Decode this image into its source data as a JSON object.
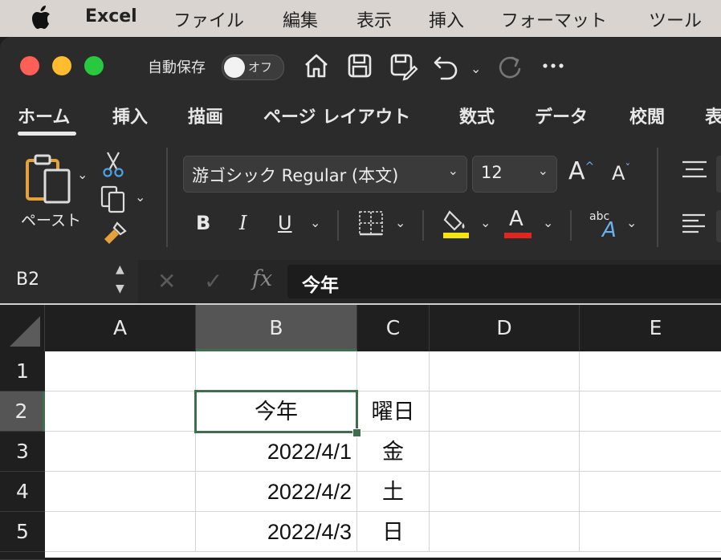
{
  "menubar": {
    "app": "Excel",
    "items": [
      "ファイル",
      "編集",
      "表示",
      "挿入",
      "フォーマット",
      "ツール"
    ]
  },
  "titlebar": {
    "autosave_label": "自動保存",
    "autosave_state": "オフ",
    "traffic_colors": {
      "close": "#ff5f57",
      "minimize": "#febc2e",
      "zoom": "#28c840"
    }
  },
  "ribbon_tabs": [
    "ホーム",
    "挿入",
    "描画",
    "ページ レイアウト",
    "数式",
    "データ",
    "校閲",
    "表"
  ],
  "ribbon": {
    "paste_label": "ペースト",
    "font_name": "游ゴシック Regular (本文)",
    "font_size": "12",
    "bold": "B",
    "italic": "I",
    "underline": "U",
    "font_color_glyph": "A",
    "grow_glyph": "A",
    "shrink_glyph": "A",
    "abc_label": "abc",
    "highlight_color": "#f5e50a",
    "font_color": "#e0261e"
  },
  "formula_bar": {
    "name_box": "B2",
    "fx": "fx",
    "value": "今年"
  },
  "sheet": {
    "columns": [
      "A",
      "B",
      "C",
      "D",
      "E"
    ],
    "rows": [
      "1",
      "2",
      "3",
      "4",
      "5"
    ],
    "cells": {
      "B2": "今年",
      "C2": "曜日",
      "B3": "2022/4/1",
      "C3": "金",
      "B4": "2022/4/2",
      "C4": "土",
      "B5": "2022/4/3",
      "C5": "日"
    },
    "selected_cell": "B2",
    "selection_color": "#3f6e4f"
  }
}
